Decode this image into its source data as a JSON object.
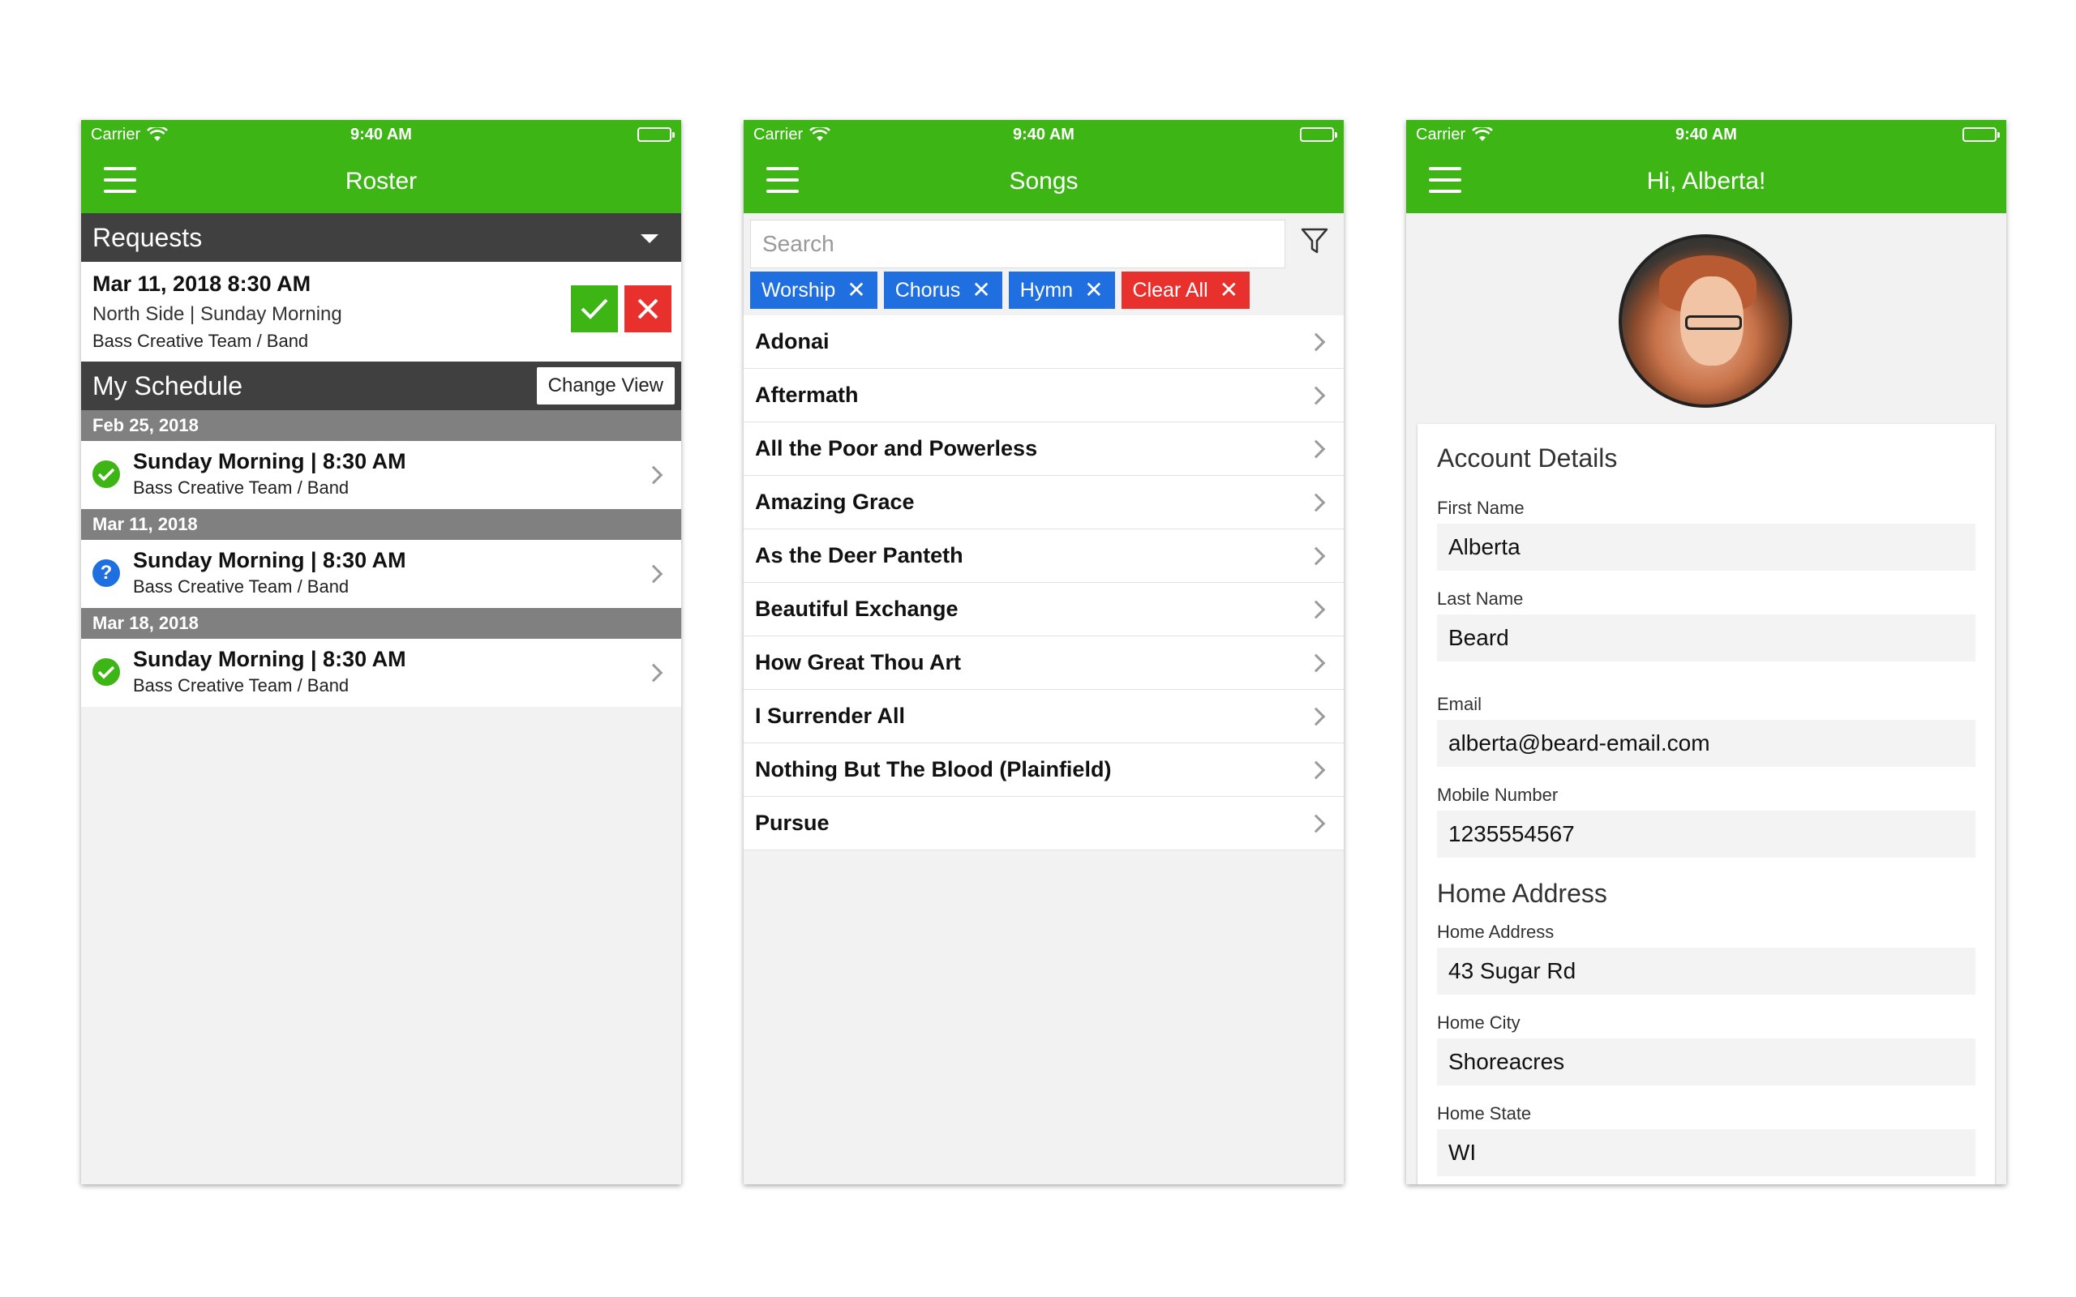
{
  "status": {
    "carrier": "Carrier",
    "time": "9:40 AM"
  },
  "colors": {
    "brand": "#3cb515",
    "section_header": "#404040",
    "date_header": "#808080",
    "tag_chip": "#1f6fe0",
    "clear_chip": "#e8302c"
  },
  "roster": {
    "title": "Roster",
    "requests_header": "Requests",
    "request": {
      "date": "Mar 11, 2018 8:30 AM",
      "location": "North Side | Sunday Morning",
      "team": "Bass Creative Team / Band"
    },
    "my_schedule_header": "My Schedule",
    "change_view_label": "Change View",
    "schedule": [
      {
        "date": "Feb 25, 2018",
        "title": "Sunday Morning | 8:30 AM",
        "team": "Bass Creative Team / Band",
        "status": "confirmed"
      },
      {
        "date": "Mar 11, 2018",
        "title": "Sunday Morning | 8:30 AM",
        "team": "Bass Creative Team / Band",
        "status": "pending"
      },
      {
        "date": "Mar 18, 2018",
        "title": "Sunday Morning | 8:30 AM",
        "team": "Bass Creative Team / Band",
        "status": "confirmed"
      }
    ]
  },
  "songs": {
    "title": "Songs",
    "search_placeholder": "Search",
    "filters": [
      "Worship",
      "Chorus",
      "Hymn"
    ],
    "clear_all_label": "Clear All",
    "items": [
      "Adonai",
      "Aftermath",
      "All the Poor and Powerless",
      "Amazing Grace",
      "As the Deer Panteth",
      "Beautiful Exchange",
      "How Great Thou Art",
      "I Surrender All",
      "Nothing But The Blood (Plainfield)",
      "Pursue"
    ]
  },
  "profile": {
    "title": "Hi, Alberta!",
    "account_heading": "Account Details",
    "first_name_label": "First Name",
    "first_name": "Alberta",
    "last_name_label": "Last Name",
    "last_name": "Beard",
    "email_label": "Email",
    "email": "alberta@beard-email.com",
    "mobile_label": "Mobile Number",
    "mobile": "1235554567",
    "home_heading": "Home Address",
    "home_address_label": "Home Address",
    "home_address": "43 Sugar Rd",
    "home_city_label": "Home City",
    "home_city": "Shoreacres",
    "home_state_label": "Home State",
    "home_state": "WI"
  }
}
